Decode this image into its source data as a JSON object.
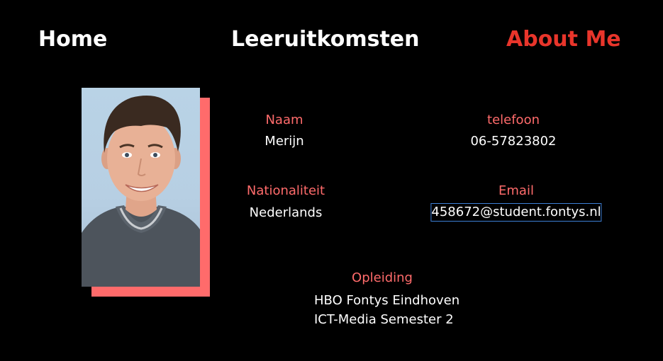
{
  "nav": {
    "home": "Home",
    "leeruitkomsten": "Leeruitkomsten",
    "about": "About Me"
  },
  "profile": {
    "name_label": "Naam",
    "name_value": "Merijn",
    "phone_label": "telefoon",
    "phone_value": "06-57823802",
    "nationality_label": "Nationaliteit",
    "nationality_value": "Nederlands",
    "email_label": "Email",
    "email_value": "458672@student.fontys.nl",
    "education_label": "Opleiding",
    "education_line1": "HBO Fontys Eindhoven",
    "education_line2": "ICT-Media Semester 2"
  },
  "colors": {
    "background": "#000000",
    "accent": "#ff6b6b",
    "active_nav": "#e8352b",
    "focus_outline": "#3d7fd6"
  }
}
